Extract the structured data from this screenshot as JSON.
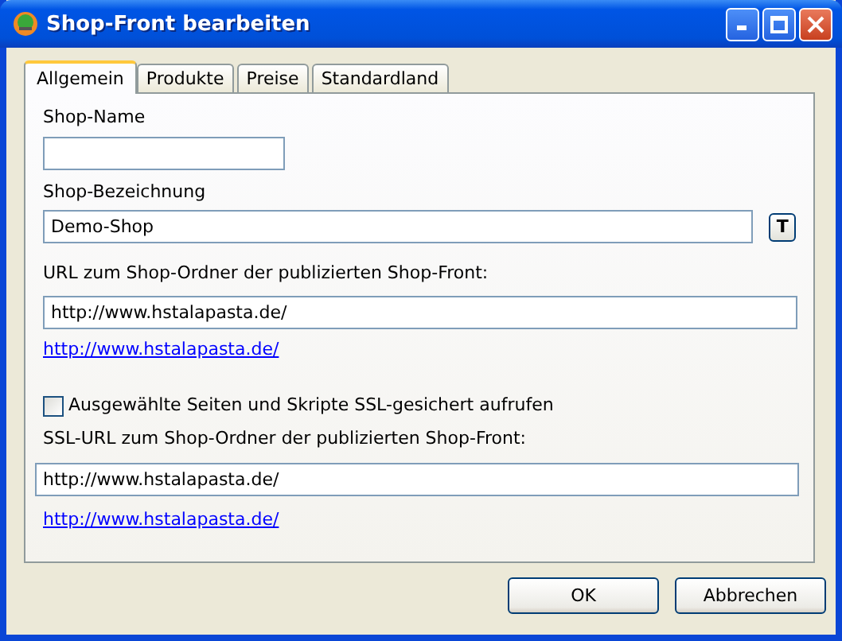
{
  "window": {
    "title": "Shop-Front bearbeiten"
  },
  "tabs": [
    {
      "label": "Allgemein",
      "selected": true
    },
    {
      "label": "Produkte",
      "selected": false
    },
    {
      "label": "Preise",
      "selected": false
    },
    {
      "label": "Standardland",
      "selected": false
    }
  ],
  "shop_name": {
    "label": "Shop-Name"
  },
  "shop_description": {
    "label": "Shop-Bezeichnung",
    "value": "Demo-Shop",
    "button": "T"
  },
  "url": {
    "label": "URL zum Shop-Ordner der publizierten Shop-Front:",
    "value": "http://www.hstalapasta.de/",
    "link": "http://www.hstalapasta.de/"
  },
  "ssl_checkbox": {
    "label": "Ausgewählte Seiten und Skripte SSL-gesichert aufrufen",
    "checked": false
  },
  "ssl_url": {
    "label": "SSL-URL zum Shop-Ordner der publizierten Shop-Front:",
    "value": "http://www.hstalapasta.de/",
    "link": "http://www.hstalapasta.de/"
  },
  "buttons": [
    "OK",
    "Abbrechen"
  ]
}
